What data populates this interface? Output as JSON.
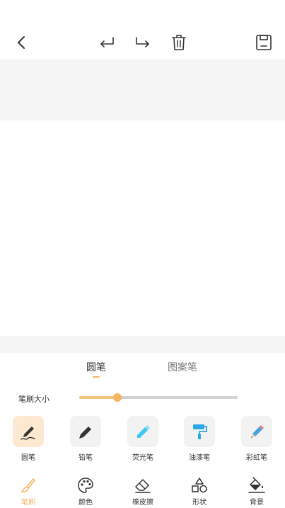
{
  "toolbar": {
    "back_icon": "chevron-left-icon",
    "undo_icon": "undo-arrow-icon",
    "redo_icon": "redo-arrow-icon",
    "delete_icon": "trash-icon",
    "save_icon": "save-icon"
  },
  "tabs": [
    {
      "label": "圆笔",
      "active": true
    },
    {
      "label": "图案笔",
      "active": false
    }
  ],
  "brush_size": {
    "label": "笔刷大小",
    "value_fraction": 0.24
  },
  "pens": [
    {
      "label": "圆笔",
      "icon": "round-pen-icon",
      "selected": true
    },
    {
      "label": "铅笔",
      "icon": "pencil-icon",
      "selected": false
    },
    {
      "label": "荧光笔",
      "icon": "highlighter-icon",
      "selected": false
    },
    {
      "label": "油漆笔",
      "icon": "paint-roller-icon",
      "selected": false
    },
    {
      "label": "彩虹笔",
      "icon": "rainbow-pencil-icon",
      "selected": false
    }
  ],
  "bottom_nav": [
    {
      "label": "笔刷",
      "icon": "brush-icon",
      "active": true
    },
    {
      "label": "颜色",
      "icon": "palette-icon",
      "active": false
    },
    {
      "label": "橡皮擦",
      "icon": "eraser-icon",
      "active": false
    },
    {
      "label": "形状",
      "icon": "shapes-icon",
      "active": false
    },
    {
      "label": "背景",
      "icon": "paint-bucket-icon",
      "active": false
    }
  ],
  "colors": {
    "accent": "#f7b461",
    "selected_tile": "#fde9d1",
    "highlighter": "#3cc8f0",
    "roller": "#2ea7e6"
  }
}
